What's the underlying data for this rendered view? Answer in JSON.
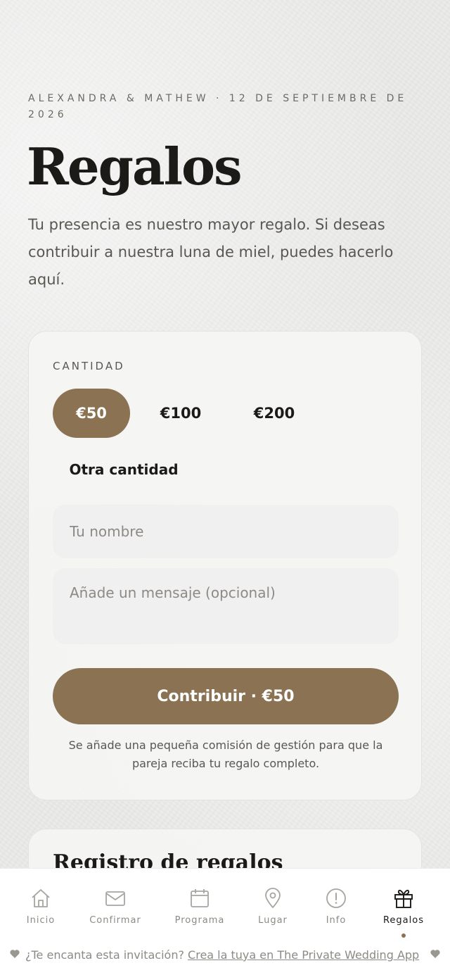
{
  "header": {
    "eyebrow": "ALEXANDRA & MATHEW  ·  12 DE SEPTIEMBRE DE 2026",
    "title": "Regalos",
    "intro": "Tu presencia es nuestro mayor regalo. Si deseas contribuir a nuestra luna de miel, puedes hacerlo aquí."
  },
  "gift_form": {
    "amount_label": "CANTIDAD",
    "amounts": [
      "€50",
      "€100",
      "€200"
    ],
    "selected_amount": "€50",
    "other_amount_label": "Otra cantidad",
    "name_placeholder": "Tu nombre",
    "message_placeholder": "Añade un mensaje (opcional)",
    "submit_label": "Contribuir · €50",
    "fee_note": "Se añade una pequeña comisión de gestión para que la pareja reciba tu regalo completo."
  },
  "registry": {
    "title": "Registro de regalos"
  },
  "tabbar": {
    "items": [
      {
        "label": "Inicio",
        "icon": "home-icon"
      },
      {
        "label": "Confirmar",
        "icon": "envelope-icon"
      },
      {
        "label": "Programa",
        "icon": "calendar-icon"
      },
      {
        "label": "Lugar",
        "icon": "location-pin-icon"
      },
      {
        "label": "Info",
        "icon": "info-icon"
      },
      {
        "label": "Regalos",
        "icon": "gift-icon"
      }
    ],
    "active": "Regalos"
  },
  "footer": {
    "prompt": "¿Te encanta esta invitación?",
    "link": "Crea la tuya en The Private Wedding App"
  },
  "colors": {
    "accent": "#8a7252",
    "text_dark": "#1c1a17",
    "text_muted": "#8d8a85"
  }
}
